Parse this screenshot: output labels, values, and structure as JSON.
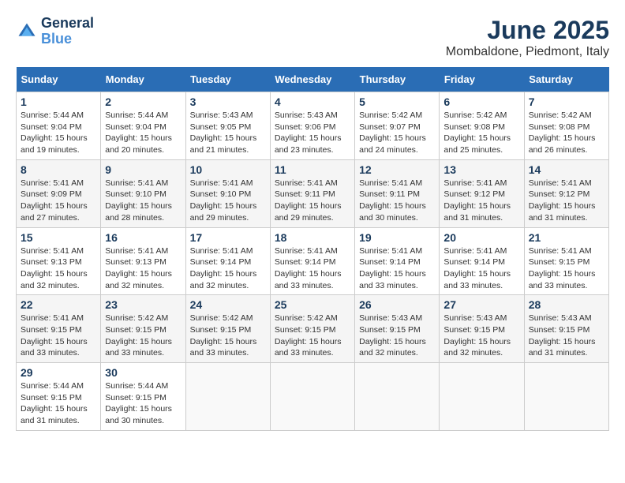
{
  "header": {
    "logo_line1": "General",
    "logo_line2": "Blue",
    "month_year": "June 2025",
    "location": "Mombaldone, Piedmont, Italy"
  },
  "days_of_week": [
    "Sunday",
    "Monday",
    "Tuesday",
    "Wednesday",
    "Thursday",
    "Friday",
    "Saturday"
  ],
  "weeks": [
    [
      {
        "day": "1",
        "info": "Sunrise: 5:44 AM\nSunset: 9:04 PM\nDaylight: 15 hours\nand 19 minutes."
      },
      {
        "day": "2",
        "info": "Sunrise: 5:44 AM\nSunset: 9:04 PM\nDaylight: 15 hours\nand 20 minutes."
      },
      {
        "day": "3",
        "info": "Sunrise: 5:43 AM\nSunset: 9:05 PM\nDaylight: 15 hours\nand 21 minutes."
      },
      {
        "day": "4",
        "info": "Sunrise: 5:43 AM\nSunset: 9:06 PM\nDaylight: 15 hours\nand 23 minutes."
      },
      {
        "day": "5",
        "info": "Sunrise: 5:42 AM\nSunset: 9:07 PM\nDaylight: 15 hours\nand 24 minutes."
      },
      {
        "day": "6",
        "info": "Sunrise: 5:42 AM\nSunset: 9:08 PM\nDaylight: 15 hours\nand 25 minutes."
      },
      {
        "day": "7",
        "info": "Sunrise: 5:42 AM\nSunset: 9:08 PM\nDaylight: 15 hours\nand 26 minutes."
      }
    ],
    [
      {
        "day": "8",
        "info": "Sunrise: 5:41 AM\nSunset: 9:09 PM\nDaylight: 15 hours\nand 27 minutes."
      },
      {
        "day": "9",
        "info": "Sunrise: 5:41 AM\nSunset: 9:10 PM\nDaylight: 15 hours\nand 28 minutes."
      },
      {
        "day": "10",
        "info": "Sunrise: 5:41 AM\nSunset: 9:10 PM\nDaylight: 15 hours\nand 29 minutes."
      },
      {
        "day": "11",
        "info": "Sunrise: 5:41 AM\nSunset: 9:11 PM\nDaylight: 15 hours\nand 29 minutes."
      },
      {
        "day": "12",
        "info": "Sunrise: 5:41 AM\nSunset: 9:11 PM\nDaylight: 15 hours\nand 30 minutes."
      },
      {
        "day": "13",
        "info": "Sunrise: 5:41 AM\nSunset: 9:12 PM\nDaylight: 15 hours\nand 31 minutes."
      },
      {
        "day": "14",
        "info": "Sunrise: 5:41 AM\nSunset: 9:12 PM\nDaylight: 15 hours\nand 31 minutes."
      }
    ],
    [
      {
        "day": "15",
        "info": "Sunrise: 5:41 AM\nSunset: 9:13 PM\nDaylight: 15 hours\nand 32 minutes."
      },
      {
        "day": "16",
        "info": "Sunrise: 5:41 AM\nSunset: 9:13 PM\nDaylight: 15 hours\nand 32 minutes."
      },
      {
        "day": "17",
        "info": "Sunrise: 5:41 AM\nSunset: 9:14 PM\nDaylight: 15 hours\nand 32 minutes."
      },
      {
        "day": "18",
        "info": "Sunrise: 5:41 AM\nSunset: 9:14 PM\nDaylight: 15 hours\nand 33 minutes."
      },
      {
        "day": "19",
        "info": "Sunrise: 5:41 AM\nSunset: 9:14 PM\nDaylight: 15 hours\nand 33 minutes."
      },
      {
        "day": "20",
        "info": "Sunrise: 5:41 AM\nSunset: 9:14 PM\nDaylight: 15 hours\nand 33 minutes."
      },
      {
        "day": "21",
        "info": "Sunrise: 5:41 AM\nSunset: 9:15 PM\nDaylight: 15 hours\nand 33 minutes."
      }
    ],
    [
      {
        "day": "22",
        "info": "Sunrise: 5:41 AM\nSunset: 9:15 PM\nDaylight: 15 hours\nand 33 minutes."
      },
      {
        "day": "23",
        "info": "Sunrise: 5:42 AM\nSunset: 9:15 PM\nDaylight: 15 hours\nand 33 minutes."
      },
      {
        "day": "24",
        "info": "Sunrise: 5:42 AM\nSunset: 9:15 PM\nDaylight: 15 hours\nand 33 minutes."
      },
      {
        "day": "25",
        "info": "Sunrise: 5:42 AM\nSunset: 9:15 PM\nDaylight: 15 hours\nand 33 minutes."
      },
      {
        "day": "26",
        "info": "Sunrise: 5:43 AM\nSunset: 9:15 PM\nDaylight: 15 hours\nand 32 minutes."
      },
      {
        "day": "27",
        "info": "Sunrise: 5:43 AM\nSunset: 9:15 PM\nDaylight: 15 hours\nand 32 minutes."
      },
      {
        "day": "28",
        "info": "Sunrise: 5:43 AM\nSunset: 9:15 PM\nDaylight: 15 hours\nand 31 minutes."
      }
    ],
    [
      {
        "day": "29",
        "info": "Sunrise: 5:44 AM\nSunset: 9:15 PM\nDaylight: 15 hours\nand 31 minutes."
      },
      {
        "day": "30",
        "info": "Sunrise: 5:44 AM\nSunset: 9:15 PM\nDaylight: 15 hours\nand 30 minutes."
      },
      {
        "day": "",
        "info": ""
      },
      {
        "day": "",
        "info": ""
      },
      {
        "day": "",
        "info": ""
      },
      {
        "day": "",
        "info": ""
      },
      {
        "day": "",
        "info": ""
      }
    ]
  ]
}
